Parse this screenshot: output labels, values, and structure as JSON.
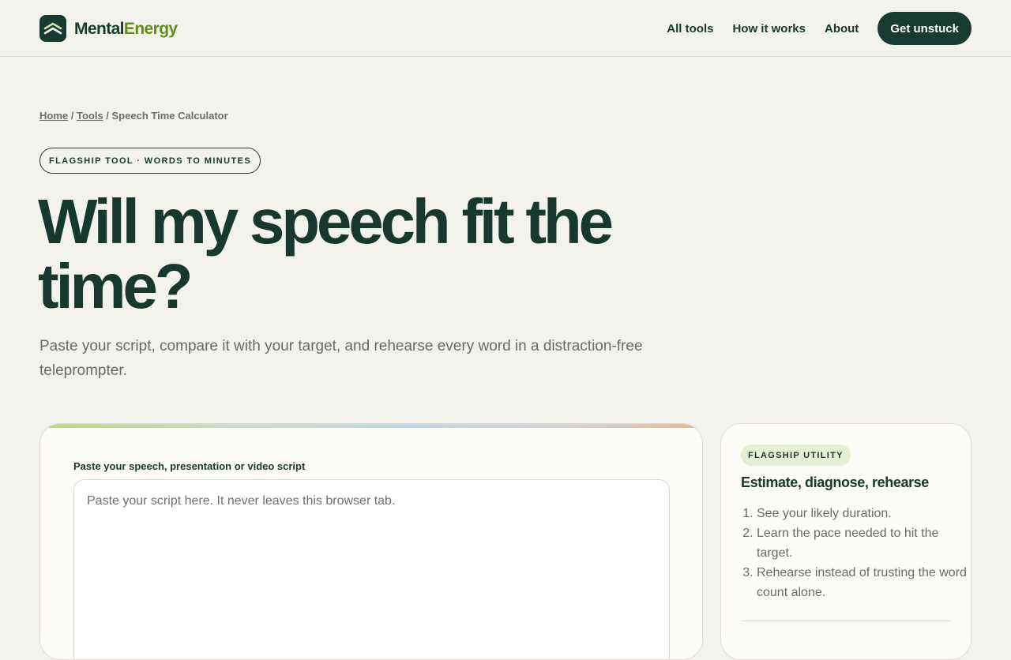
{
  "header": {
    "logo": {
      "part1": "Mental",
      "part2": "Energy"
    },
    "nav": [
      {
        "label": "All tools"
      },
      {
        "label": "How it works"
      },
      {
        "label": "About"
      }
    ],
    "cta_label": "Get unstuck"
  },
  "breadcrumb": {
    "home": "Home",
    "sep1": " / ",
    "tools": "Tools",
    "sep2": " / ",
    "current": "Speech Time Calculator"
  },
  "hero": {
    "badge": "FLAGSHIP TOOL · WORDS TO MINUTES",
    "title": "Will my speech fit the time?",
    "subtitle": "Paste your script, compare it with your target, and rehearse every word in a distraction-free teleprompter."
  },
  "editor": {
    "label": "Paste your speech, presentation or video script",
    "placeholder": "Paste your script here. It never leaves this browser tab.",
    "value": ""
  },
  "sidebar": {
    "badge": "FLAGSHIP UTILITY",
    "heading": "Estimate, diagnose, rehearse",
    "steps": [
      "See your likely duration.",
      "Learn the pace needed to hit the target.",
      "Rehearse instead of trusting the word count alone."
    ]
  },
  "colors": {
    "background": "#f3f2ec",
    "primary": "#173a31",
    "accent_green": "#5e8c1f",
    "muted_text": "#6a6a66",
    "badge_tint": "#e3f0d3"
  },
  "icons": {
    "logo": "double-chevron-up-icon"
  }
}
